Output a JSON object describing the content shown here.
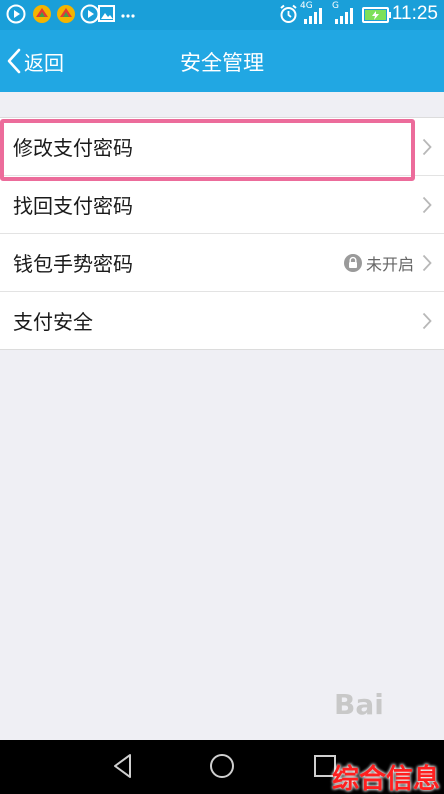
{
  "status_bar": {
    "time": "11:25",
    "network_label": "4G",
    "signal_label": "G",
    "icons": [
      "play-icon",
      "game-icon",
      "game-icon",
      "play-icon",
      "image-icon",
      "more-icon",
      "alarm-icon",
      "signal-icon",
      "signal-icon",
      "battery-icon"
    ]
  },
  "header": {
    "back_label": "返回",
    "title": "安全管理"
  },
  "settings": {
    "items": [
      {
        "label": "修改支付密码"
      },
      {
        "label": "找回支付密码"
      },
      {
        "label": "钱包手势密码",
        "status": "未开启"
      },
      {
        "label": "支付安全"
      }
    ]
  },
  "watermark": {
    "baidu": "Bai",
    "site": "综合信息"
  },
  "nav_bar": {
    "icons": [
      "back-icon",
      "home-icon",
      "recents-icon"
    ]
  },
  "colors": {
    "title_bar": "#21a7e3",
    "status_bar": "#1a9fd9",
    "highlight": "#ec6c9b",
    "background": "#efeff4"
  }
}
